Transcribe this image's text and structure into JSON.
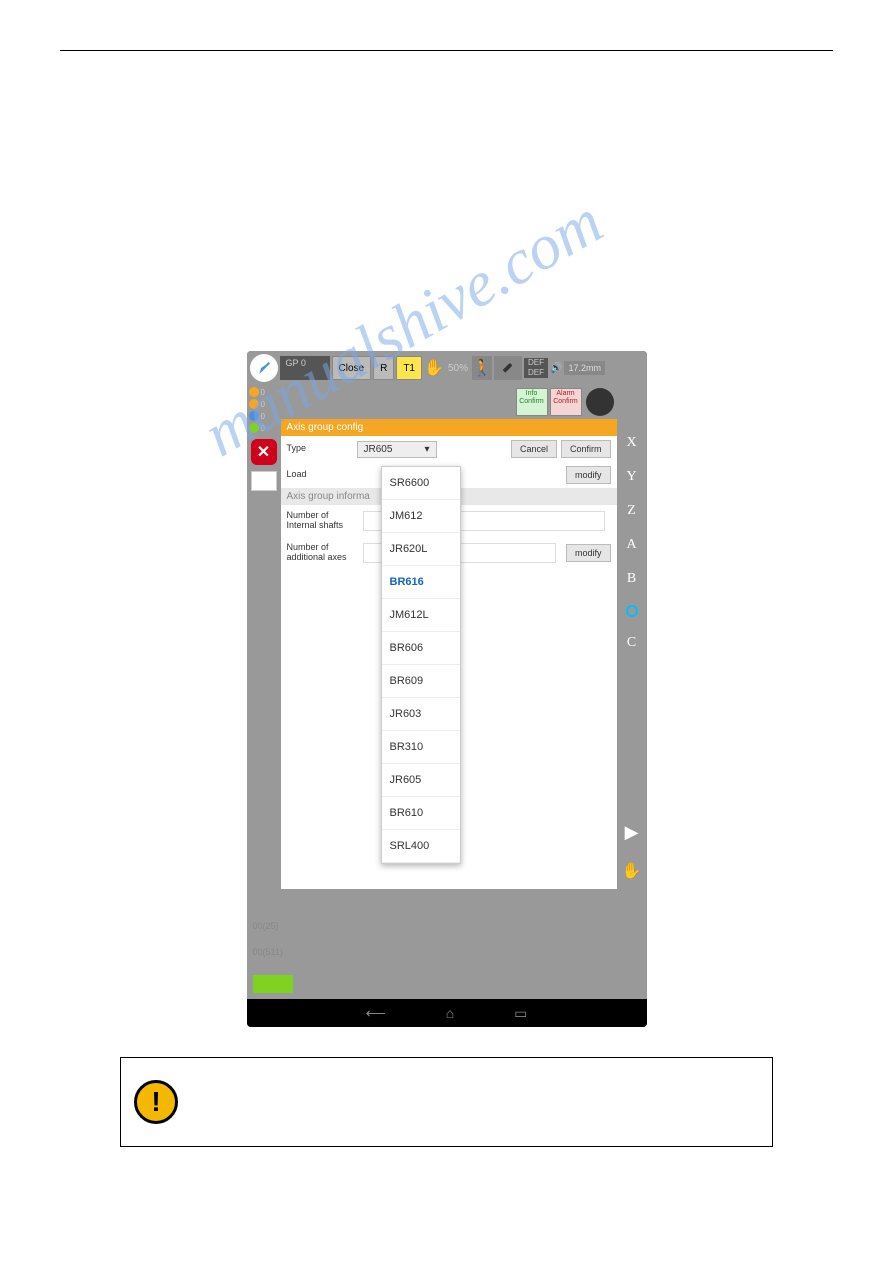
{
  "topbar": {
    "gp_label": "GP 0",
    "close": "Close",
    "r": "R",
    "t1": "T1",
    "percent": "50%",
    "def": "DEF",
    "dim": "17.2mm"
  },
  "info_alarm": {
    "info": "Info Confirm",
    "alarm": "Alarm Confirm"
  },
  "orange_header": "Axis group config",
  "form": {
    "type_label": "Type",
    "type_value": "JR605",
    "cancel": "Cancel",
    "confirm": "Confirm",
    "load_label": "Load",
    "modify": "modify",
    "section_header": "Axis group informa",
    "internal_label": "Number of Internal shafts",
    "additional_label": "Number of additional axes"
  },
  "dropdown_items": [
    "SR6600",
    "JM612",
    "JR620L",
    "BR616",
    "JM612L",
    "BR606",
    "BR609",
    "JR603",
    "BR310",
    "JR605",
    "BR610",
    "SRL400"
  ],
  "rail_labels": {
    "x": "X",
    "y": "Y",
    "z": "Z",
    "a": "A",
    "b": "B",
    "c": "C"
  },
  "bottom_txt": {
    "t1": "00(25)",
    "t2": "00(511)"
  }
}
